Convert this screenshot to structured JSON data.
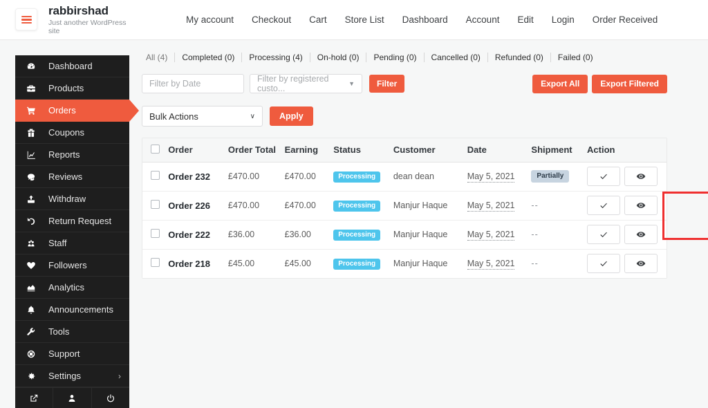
{
  "header": {
    "logo_icon": "hamburger-icon",
    "brand_title": "rabbirshad",
    "brand_tagline": "Just another WordPress site",
    "nav": [
      {
        "label": "My account"
      },
      {
        "label": "Checkout"
      },
      {
        "label": "Cart"
      },
      {
        "label": "Store List"
      },
      {
        "label": "Dashboard"
      },
      {
        "label": "Account"
      },
      {
        "label": "Edit"
      },
      {
        "label": "Login"
      },
      {
        "label": "Order Received"
      }
    ]
  },
  "sidebar": {
    "active_item": "Orders",
    "items": [
      {
        "label": "Dashboard",
        "icon": "gauge-icon"
      },
      {
        "label": "Products",
        "icon": "briefcase-icon"
      },
      {
        "label": "Orders",
        "icon": "cart-icon"
      },
      {
        "label": "Coupons",
        "icon": "gift-icon"
      },
      {
        "label": "Reports",
        "icon": "chart-line-icon"
      },
      {
        "label": "Reviews",
        "icon": "comment-icon"
      },
      {
        "label": "Withdraw",
        "icon": "upload-icon"
      },
      {
        "label": "Return Request",
        "icon": "undo-icon"
      },
      {
        "label": "Staff",
        "icon": "users-icon"
      },
      {
        "label": "Followers",
        "icon": "heart-icon"
      },
      {
        "label": "Analytics",
        "icon": "chart-area-icon"
      },
      {
        "label": "Announcements",
        "icon": "bell-icon"
      },
      {
        "label": "Tools",
        "icon": "wrench-icon"
      },
      {
        "label": "Support",
        "icon": "lifebuoy-icon"
      },
      {
        "label": "Settings",
        "icon": "gear-icon",
        "chevron": "›"
      }
    ],
    "footer_icons": [
      {
        "name": "external-link-icon"
      },
      {
        "name": "user-icon"
      },
      {
        "name": "power-icon"
      }
    ]
  },
  "status_tabs": [
    {
      "label": "All (4)",
      "current": true
    },
    {
      "label": "Completed (0)",
      "current": false
    },
    {
      "label": "Processing (4)",
      "current": false
    },
    {
      "label": "On-hold (0)",
      "current": false
    },
    {
      "label": "Pending (0)",
      "current": false
    },
    {
      "label": "Cancelled (0)",
      "current": false
    },
    {
      "label": "Refunded (0)",
      "current": false
    },
    {
      "label": "Failed (0)",
      "current": false
    }
  ],
  "filters": {
    "date_placeholder": "Filter by Date",
    "date_value": "",
    "customer_value": "Filter by registered custo...",
    "customer_caret": "▼",
    "filter_button": "Filter",
    "export_all": "Export All",
    "export_filtered": "Export Filtered"
  },
  "bulk": {
    "selected": "Bulk Actions",
    "caret": "∨",
    "apply_label": "Apply"
  },
  "table": {
    "columns": [
      {
        "key": "checkbox",
        "label": ""
      },
      {
        "key": "order",
        "label": "Order"
      },
      {
        "key": "total",
        "label": "Order Total"
      },
      {
        "key": "earning",
        "label": "Earning"
      },
      {
        "key": "status",
        "label": "Status"
      },
      {
        "key": "customer",
        "label": "Customer"
      },
      {
        "key": "date",
        "label": "Date"
      },
      {
        "key": "shipment",
        "label": "Shipment"
      },
      {
        "key": "action",
        "label": "Action"
      }
    ],
    "highlighted_column": "Shipment",
    "highlight_color": "#ef2f2f",
    "rows": [
      {
        "order": "Order 232",
        "total": "£470.00",
        "earning": "£470.00",
        "status": "Processing",
        "customer": "dean dean",
        "date": "May 5, 2021",
        "shipment": "Partially",
        "shipment_is_badge": true,
        "actions": [
          "check-icon",
          "eye-icon"
        ]
      },
      {
        "order": "Order 226",
        "total": "£470.00",
        "earning": "£470.00",
        "status": "Processing",
        "customer": "Manjur Haque",
        "date": "May 5, 2021",
        "shipment": "--",
        "shipment_is_badge": false,
        "actions": [
          "check-icon",
          "eye-icon"
        ]
      },
      {
        "order": "Order 222",
        "total": "£36.00",
        "earning": "£36.00",
        "status": "Processing",
        "customer": "Manjur Haque",
        "date": "May 5, 2021",
        "shipment": "--",
        "shipment_is_badge": false,
        "actions": [
          "check-icon",
          "eye-icon"
        ]
      },
      {
        "order": "Order 218",
        "total": "£45.00",
        "earning": "£45.00",
        "status": "Processing",
        "customer": "Manjur Haque",
        "date": "May 5, 2021",
        "shipment": "--",
        "shipment_is_badge": false,
        "actions": [
          "check-icon",
          "eye-icon"
        ]
      }
    ]
  },
  "colors": {
    "accent": "#ef5b3e",
    "sidebar_bg": "#1e1e1e",
    "status_badge": "#4ec5ec",
    "shipment_badge": "#c7d4e0",
    "page_bg": "#f6f7f7"
  }
}
